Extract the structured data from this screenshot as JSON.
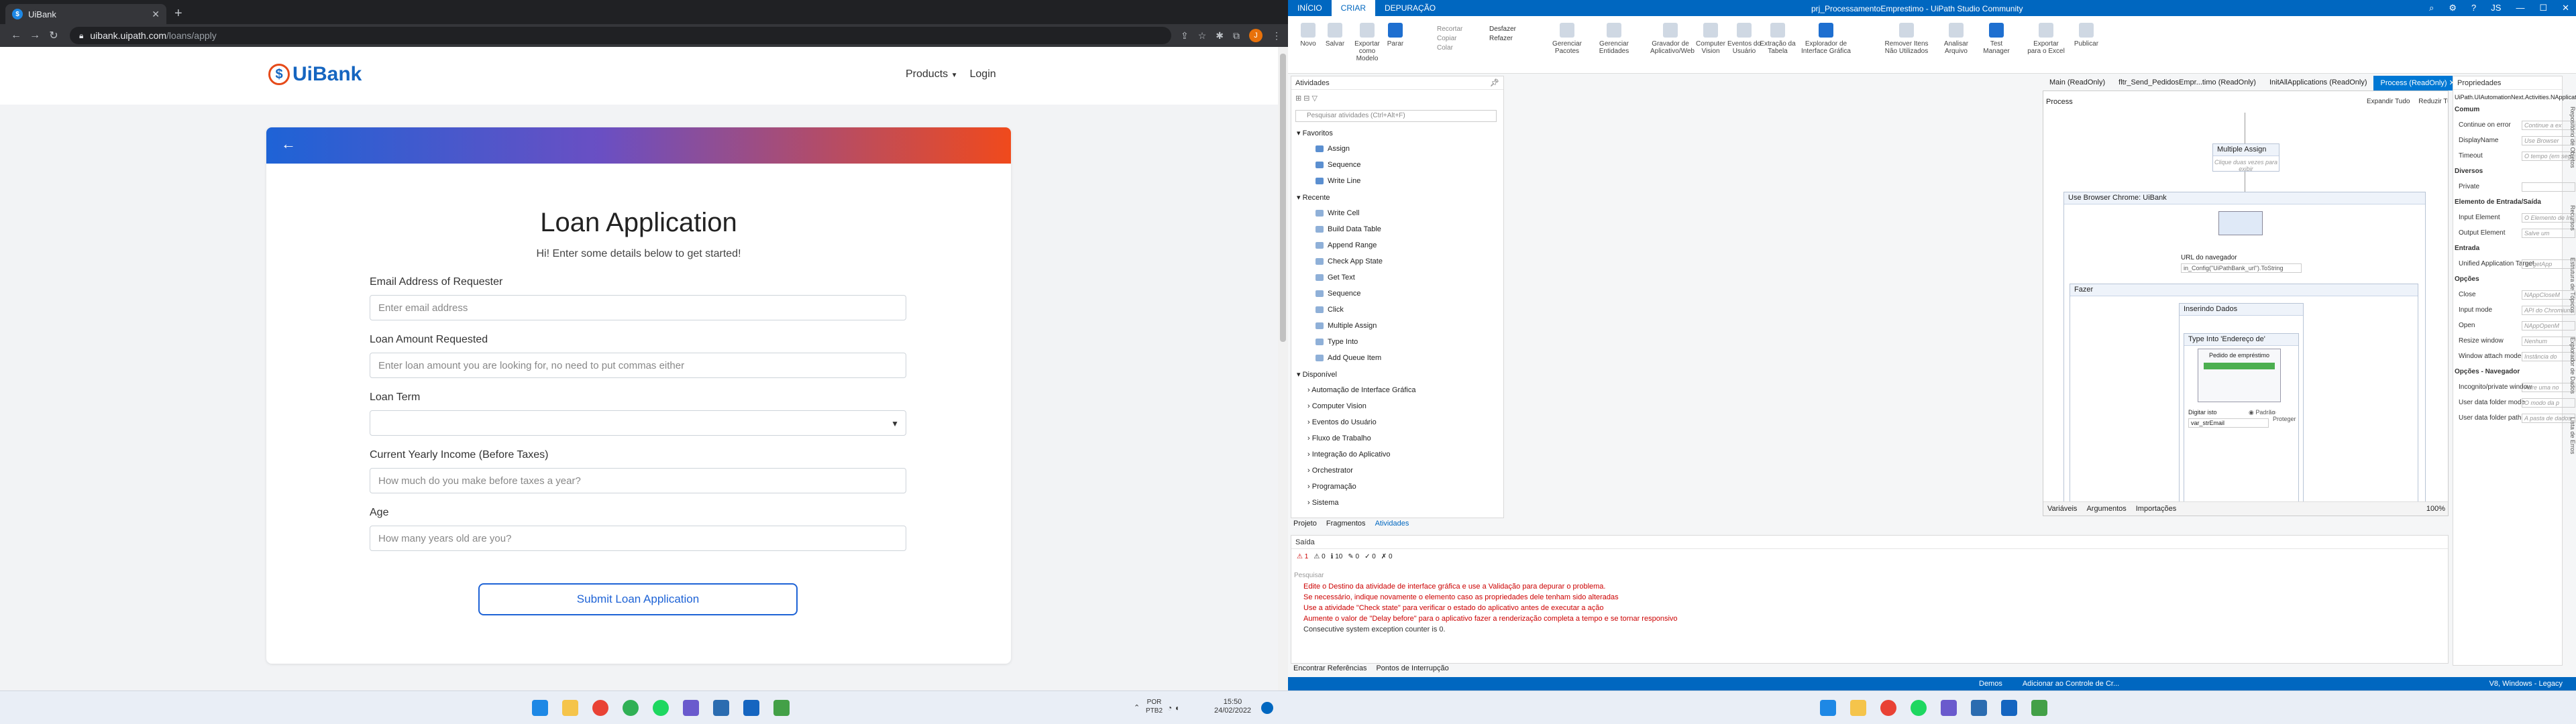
{
  "browser": {
    "tab_title": "UiBank",
    "url_host": "uibank.uipath.com",
    "url_path": "/loans/apply",
    "avatar_letter": "J"
  },
  "site": {
    "logo_text": "UiBank",
    "nav": {
      "products": "Products",
      "login": "Login"
    }
  },
  "form": {
    "title": "Loan Application",
    "subtitle": "Hi! Enter some details below to get started!",
    "fields": [
      {
        "label": "Email Address of Requester",
        "placeholder": "Enter email address"
      },
      {
        "label": "Loan Amount Requested",
        "placeholder": "Enter loan amount you are looking for, no need to put commas either"
      },
      {
        "label": "Loan Term",
        "placeholder": ""
      },
      {
        "label": "Current Yearly Income (Before Taxes)",
        "placeholder": "How much do you make before taxes a year?"
      },
      {
        "label": "Age",
        "placeholder": "How many years old are you?"
      }
    ],
    "submit_label": "Submit Loan Application"
  },
  "studio": {
    "window_title": "prj_ProcessamentoEmprestimo - UiPath Studio Community",
    "ribbon_tabs": [
      "INÍCIO",
      "CRIAR",
      "DEPURAÇÃO"
    ],
    "ribbon_buttons": [
      "Novo",
      "Salvar",
      "Exportar como Modelo",
      "Parar",
      "Gerenciar Pacotes",
      "Gerenciar Entidades",
      "Gravador de Aplicativo/Web",
      "Computer Vision",
      "Eventos do Usuário",
      "Extração da Tabela",
      "Explorador de Interface Gráfica",
      "Remover Itens Não Utilizados",
      "Analisar Arquivo",
      "Test Manager",
      "Exportar para o Excel",
      "Publicar"
    ],
    "ribbon_small": [
      "Recortar",
      "Copiar",
      "Colar",
      "Desfazer",
      "Refazer"
    ],
    "activities_title": "Atividades",
    "search_placeholder": "Pesquisar atividades (Ctrl+Alt+F)",
    "favorites_label": "Favoritos",
    "favorites": [
      "Assign",
      "Sequence",
      "Write Line"
    ],
    "recent_label": "Recente",
    "recent": [
      "Write Cell",
      "Build Data Table",
      "Append Range",
      "Check App State",
      "Get Text",
      "Sequence",
      "Click",
      "Multiple Assign",
      "Type Into",
      "Add Queue Item"
    ],
    "available_label": "Disponível",
    "available": [
      "Automação de Interface Gráfica",
      "Computer Vision",
      "Eventos do Usuário",
      "Fluxo de Trabalho",
      "Integração do Aplicativo",
      "Orchestrator",
      "Programação",
      "Sistema"
    ],
    "left_bottom_tabs": [
      "Projeto",
      "Fragmentos",
      "Atividades"
    ],
    "doc_tabs": [
      "Main (ReadOnly)",
      "fltr_Send_PedidosEmpr...timo (ReadOnly)",
      "InitAllApplications (ReadOnly)",
      "Process (ReadOnly)"
    ],
    "breadcrumb": "Process",
    "expand_all": "Expandir Tudo",
    "collapse_all": "Reduzir Tudo",
    "multiple_assign": "Multiple Assign",
    "multiple_assign_hint": "Clique duas vezes para exibir",
    "use_browser": "Use Browser Chrome: UiBank",
    "url_label": "URL do navegador",
    "url_value": "in_Config(\"UiPathBank_url\").ToString",
    "do_label": "Fazer",
    "inserting_data": "Inserindo Dados",
    "type_into": "Type Into 'Endereço de'",
    "preview_title": "Pedido de empréstimo",
    "type_this": "Digitar isto",
    "radio_default": "Padrão",
    "radio_protect": "Proteger",
    "type_value": "var_strEmail",
    "designer_bottom_tabs": [
      "Variáveis",
      "Argumentos",
      "Importações"
    ],
    "zoom": "100%",
    "output_title": "Saída",
    "output_search": "Pesquisar",
    "output_counts": [
      "1",
      "0",
      "10",
      "0",
      "0",
      "0"
    ],
    "output_lines": [
      "Edite o Destino da atividade de interface gráfica e use a Validação para depurar o problema.",
      "Se necessário, indique novamente o elemento caso as propriedades dele tenham sido alteradas",
      "Use a atividade \"Check state\" para verificar o estado do aplicativo antes de executar a ação",
      "Aumente o valor de \"Delay before\" para o aplicativo fazer a renderização completa a tempo e se tornar responsivo",
      "Consecutive system exception counter is 0."
    ],
    "output_bottom_tabs": [
      "Encontrar Referências",
      "Pontos de Interrupção"
    ],
    "props_title": "Propriedades",
    "props_class": "UiPath.UIAutomationNext.Activities.NApplicationCard",
    "props": [
      {
        "type": "section",
        "label": "Comum"
      },
      {
        "type": "row",
        "label": "Continue on error",
        "value": "Continue a ex"
      },
      {
        "type": "row",
        "label": "DisplayName",
        "value": "Use Browser Chrome"
      },
      {
        "type": "row",
        "label": "Timeout",
        "value": "O tempo (em seg"
      },
      {
        "type": "section",
        "label": "Diversos"
      },
      {
        "type": "row",
        "label": "Private",
        "value": ""
      },
      {
        "type": "section",
        "label": "Elemento de Entrada/Saída"
      },
      {
        "type": "row",
        "label": "Input Element",
        "value": "O Elemento de In"
      },
      {
        "type": "row",
        "label": "Output Element",
        "value": "Salve um Element"
      },
      {
        "type": "section",
        "label": "Entrada"
      },
      {
        "type": "row",
        "label": "Unified Application Target",
        "value": "TargetApp"
      },
      {
        "type": "section",
        "label": "Opções"
      },
      {
        "type": "row",
        "label": "Close",
        "value": "NAppCloseM"
      },
      {
        "type": "row",
        "label": "Input mode",
        "value": "API do Chromium"
      },
      {
        "type": "row",
        "label": "Open",
        "value": "NAppOpenM"
      },
      {
        "type": "row",
        "label": "Resize window",
        "value": "Nenhum"
      },
      {
        "type": "row",
        "label": "Window attach mode",
        "value": "Instância do aplicat"
      },
      {
        "type": "section",
        "label": "Opções - Navegador"
      },
      {
        "type": "row",
        "label": "Incognito/private window",
        "value": "Abre uma no"
      },
      {
        "type": "row",
        "label": "User data folder mode",
        "value": "O modo da p"
      },
      {
        "type": "row",
        "label": "User data folder path",
        "value": "A pasta de dados"
      }
    ],
    "side_tabs": [
      "Repositório de Objetos",
      "Recursos",
      "Estrutura de Tópicos",
      "Explorador de Dados",
      "Lista de Erros"
    ],
    "status_left": "Demos",
    "status_mid": "Adicionar ao Controle de Cr...",
    "status_right": "V8, Windows - Legacy"
  },
  "taskbar": {
    "lang": "POR",
    "lang2": "PTB2",
    "time": "15:50",
    "date": "24/02/2022"
  }
}
